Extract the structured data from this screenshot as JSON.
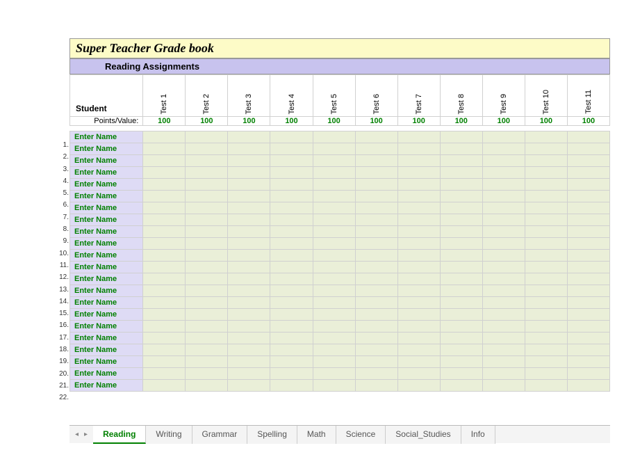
{
  "title": "Super Teacher Grade book",
  "subtitle": "Reading Assignments",
  "headers": {
    "student": "Student",
    "points_label": "Points/Value:",
    "tests": [
      "Test 1",
      "Test 2",
      "Test 3",
      "Test 4",
      "Test 5",
      "Test 6",
      "Test 7",
      "Test 8",
      "Test 9",
      "Test 10",
      "Test 11"
    ],
    "points": [
      "100",
      "100",
      "100",
      "100",
      "100",
      "100",
      "100",
      "100",
      "100",
      "100",
      "100"
    ]
  },
  "rows": [
    {
      "num": "1.",
      "name": "Enter Name"
    },
    {
      "num": "2.",
      "name": "Enter Name"
    },
    {
      "num": "3.",
      "name": "Enter Name"
    },
    {
      "num": "4.",
      "name": "Enter Name"
    },
    {
      "num": "5.",
      "name": "Enter Name"
    },
    {
      "num": "6.",
      "name": "Enter Name"
    },
    {
      "num": "7.",
      "name": "Enter Name"
    },
    {
      "num": "8.",
      "name": "Enter Name"
    },
    {
      "num": "9.",
      "name": "Enter Name"
    },
    {
      "num": "10.",
      "name": "Enter Name"
    },
    {
      "num": "11.",
      "name": "Enter Name"
    },
    {
      "num": "12.",
      "name": "Enter Name"
    },
    {
      "num": "13.",
      "name": "Enter Name"
    },
    {
      "num": "14.",
      "name": "Enter Name"
    },
    {
      "num": "15.",
      "name": "Enter Name"
    },
    {
      "num": "16.",
      "name": "Enter Name"
    },
    {
      "num": "17.",
      "name": "Enter Name"
    },
    {
      "num": "18.",
      "name": "Enter Name"
    },
    {
      "num": "19.",
      "name": "Enter Name"
    },
    {
      "num": "20.",
      "name": "Enter Name"
    },
    {
      "num": "21.",
      "name": "Enter Name"
    },
    {
      "num": "22.",
      "name": "Enter Name"
    }
  ],
  "tabs": [
    "Reading",
    "Writing",
    "Grammar",
    "Spelling",
    "Math",
    "Science",
    "Social_Studies",
    "Info"
  ],
  "active_tab": "Reading"
}
